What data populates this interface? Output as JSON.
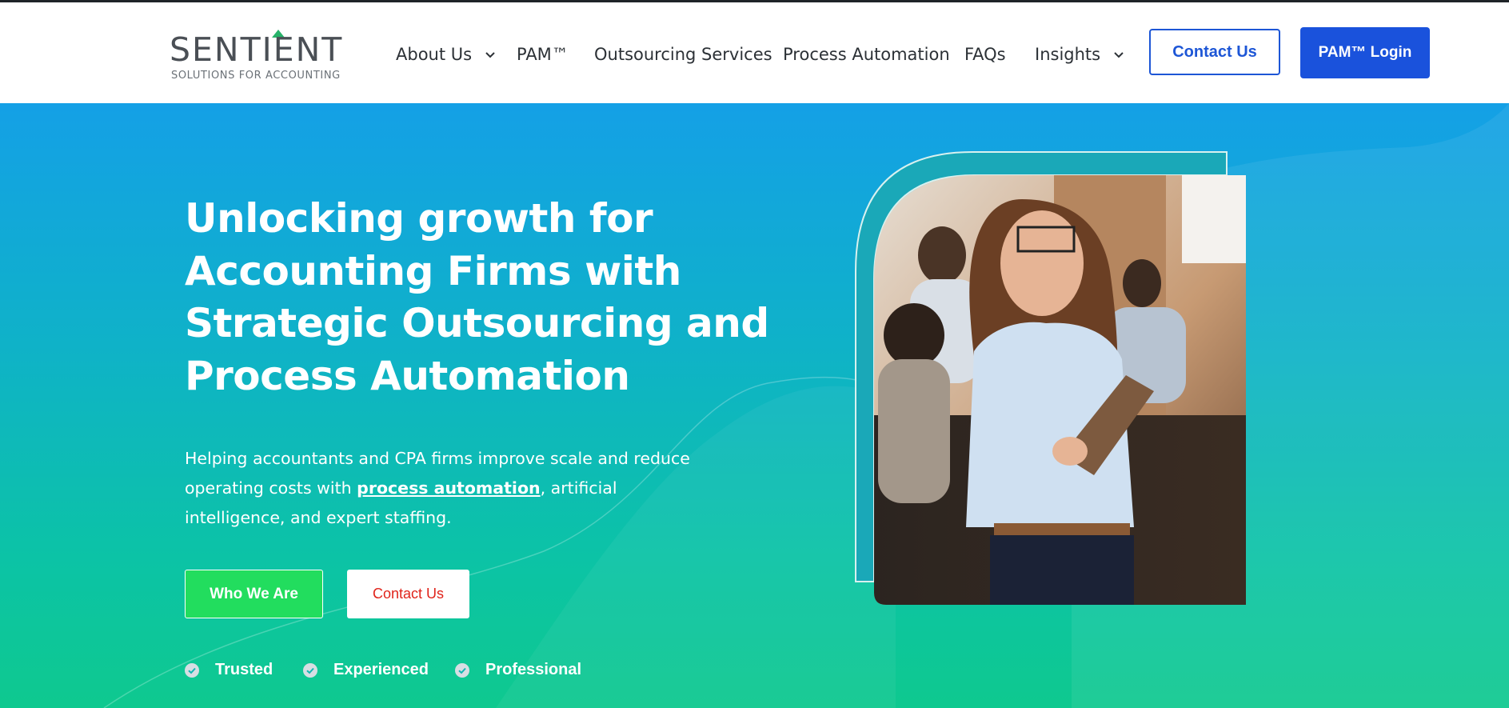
{
  "logo": {
    "name": "SENTIENT",
    "tagline": "SOLUTIONS FOR ACCOUNTING"
  },
  "nav": {
    "items": [
      {
        "label": "About Us",
        "has_dropdown": true
      },
      {
        "label": "PAM™",
        "has_dropdown": false
      },
      {
        "label": "Outsourcing Services",
        "has_dropdown": false
      },
      {
        "label": "Process Automation",
        "has_dropdown": false
      },
      {
        "label": "FAQs",
        "has_dropdown": false
      },
      {
        "label": "Insights",
        "has_dropdown": true
      }
    ],
    "contact_label": "Contact Us",
    "login_label": "PAM™ Login"
  },
  "hero": {
    "headline_lines": [
      "Unlocking growth for",
      "Accounting Firms with",
      "Strategic Outsourcing and",
      "Process Automation"
    ],
    "sub_before": "Helping accountants and CPA firms improve scale and reduce operating costs with ",
    "sub_link": "process automation",
    "sub_after": ", artificial intelligence, and expert staffing.",
    "primary_cta": "Who We Are",
    "secondary_cta": "Contact Us",
    "badges": [
      "Trusted",
      "Experienced",
      "Professional"
    ]
  },
  "icons": {
    "nav_dropdown": "chevron-down-icon",
    "badge": "check-circle-icon"
  },
  "colors": {
    "brand_blue": "#1a52dc",
    "hero_top": "#14a0e6",
    "hero_bottom": "#0ec98f",
    "cta_green": "#22dd5e",
    "cta_red_text": "#e0241b",
    "logo_arrow": "#27b36a"
  }
}
